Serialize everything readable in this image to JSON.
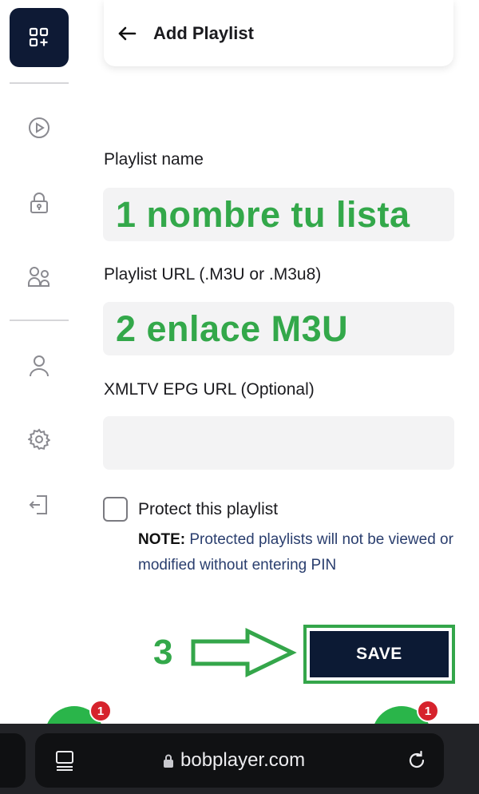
{
  "header": {
    "title": "Add Playlist"
  },
  "sidebar": {
    "icons": [
      "playlists-icon",
      "play-circle-icon",
      "lock-icon",
      "users-icon",
      "user-icon",
      "gear-icon",
      "logout-icon"
    ]
  },
  "form": {
    "name_label": "Playlist name",
    "name_value": "1 nombre tu lista",
    "url_label": "Playlist URL (.M3U or .M3u8)",
    "url_value": "2 enlace M3U",
    "epg_label": "XMLTV EPG URL (Optional)",
    "epg_value": "",
    "protect_label": "Protect this playlist",
    "note_prefix": "NOTE:",
    "note_text": " Protected playlists will not be viewed or modified without entering PIN",
    "save_label": "SAVE",
    "step_marker": "3"
  },
  "badges": {
    "left": "1",
    "right": "1"
  },
  "browser": {
    "url": "bobplayer.com"
  },
  "colors": {
    "navy": "#0e1a35",
    "annotation_green": "#33a84a",
    "badge_red": "#d6232d"
  }
}
